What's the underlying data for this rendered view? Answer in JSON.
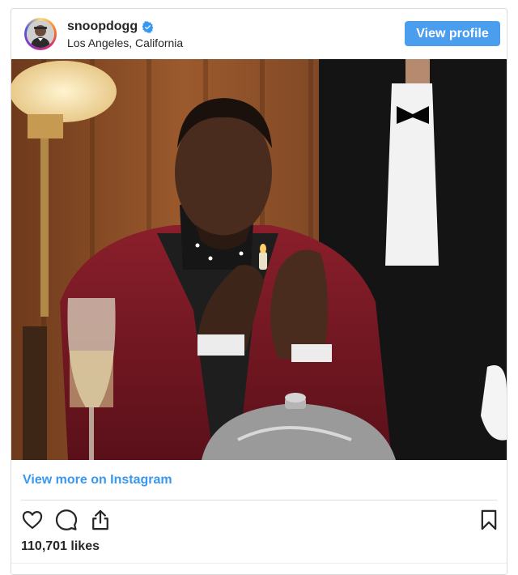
{
  "post": {
    "username": "snoopdogg",
    "location": "Los Angeles, California",
    "view_profile_label": "View profile",
    "view_more_label": "View more on Instagram",
    "likes": "110,701 likes"
  },
  "icons": {
    "verified": "verified-badge-icon",
    "like": "heart-icon",
    "comment": "comment-icon",
    "share": "share-icon",
    "save": "bookmark-icon"
  },
  "colors": {
    "accent": "#4a9eed",
    "link": "#3897f0",
    "border": "#dbdbdb"
  }
}
